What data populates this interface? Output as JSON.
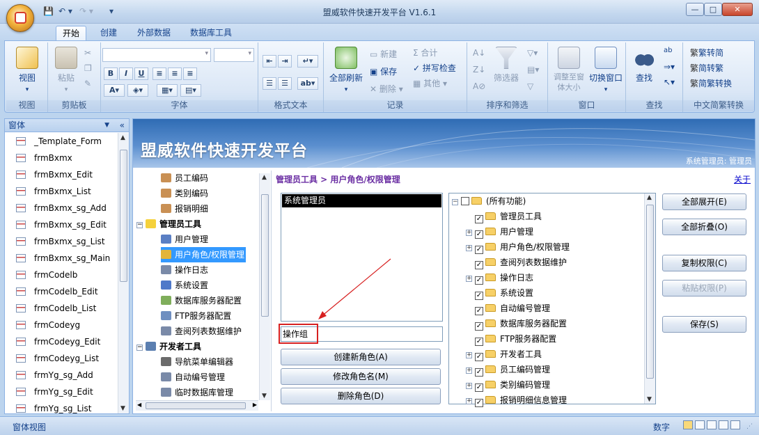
{
  "window": {
    "title": "盟威软件快速开发平台 V1.6.1",
    "minimize": "—",
    "maximize": "□",
    "close": "✕"
  },
  "quick_access": [
    "💾",
    "↶ ▾",
    "↷ ▾",
    "▾"
  ],
  "ribbon_tabs": [
    "开始",
    "创建",
    "外部数据",
    "数据库工具"
  ],
  "ribbon_right": [
    "?",
    "–",
    "▫",
    "✕"
  ],
  "ribbon": {
    "groups": [
      {
        "label": "视图",
        "buttons": [
          "视图"
        ]
      },
      {
        "label": "剪贴板",
        "buttons": [
          "粘贴"
        ]
      },
      {
        "label": "字体",
        "buttons": [
          "B",
          "I",
          "U"
        ]
      },
      {
        "label": "格式文本",
        "buttons": []
      },
      {
        "label": "记录",
        "buttons": [
          "全部刷新",
          "新建",
          "保存",
          "删除",
          "合计",
          "拼写检查",
          "其他"
        ]
      },
      {
        "label": "排序和筛选",
        "buttons": [
          "筛选器"
        ]
      },
      {
        "label": "窗口",
        "buttons": [
          "调整至窗体大小",
          "切换窗口"
        ]
      },
      {
        "label": "查找",
        "buttons": [
          "查找"
        ]
      },
      {
        "label": "中文简繁转换",
        "buttons": [
          "繁转简",
          "简转繁",
          "简繁转换"
        ]
      }
    ]
  },
  "leftnav": {
    "header": "窗体",
    "items": [
      "_Template_Form",
      "frmBxmx",
      "frmBxmx_Edit",
      "frmBxmx_List",
      "frmBxmx_sg_Add",
      "frmBxmx_sg_Edit",
      "frmBxmx_sg_List",
      "frmBxmx_sg_Main",
      "frmCodelb",
      "frmCodelb_Edit",
      "frmCodelb_List",
      "frmCodeyg",
      "frmCodeyg_Edit",
      "frmCodeyg_List",
      "frmYg_sg_Add",
      "frmYg_sg_Edit",
      "frmYg_sg_List"
    ]
  },
  "banner": {
    "title": "盟威软件快速开发平台",
    "user": "系统管理员: 管理员"
  },
  "menu_tree": [
    {
      "label": "员工编码",
      "level": 2
    },
    {
      "label": "类别编码",
      "level": 2
    },
    {
      "label": "报销明细",
      "level": 2
    },
    {
      "label": "管理员工具",
      "level": 1
    },
    {
      "label": "用户管理",
      "level": 2
    },
    {
      "label": "用户角色/权限管理",
      "level": 2
    },
    {
      "label": "操作日志",
      "level": 2
    },
    {
      "label": "系统设置",
      "level": 2
    },
    {
      "label": "数据库服务器配置",
      "level": 2
    },
    {
      "label": "FTP服务器配置",
      "level": 2
    },
    {
      "label": "查阅列表数据维护",
      "level": 2
    },
    {
      "label": "开发者工具",
      "level": 1
    },
    {
      "label": "导航菜单编辑器",
      "level": 2
    },
    {
      "label": "自动编号管理",
      "level": 2
    },
    {
      "label": "临时数据库管理",
      "level": 2
    }
  ],
  "breadcrumb": "管理员工具 > 用户角色/权限管理",
  "about_link": "关于",
  "roles": {
    "items": [
      "系统管理员"
    ],
    "input_value": "操作组"
  },
  "role_buttons": [
    "创建新角色(A)",
    "修改角色名(M)",
    "删除角色(D)"
  ],
  "permission_tree": {
    "root": "(所有功能)",
    "items": [
      "管理员工具",
      "用户管理",
      "用户角色/权限管理",
      "查阅列表数据维护",
      "操作日志",
      "系统设置",
      "自动编号管理",
      "数据库服务器配置",
      "FTP服务器配置",
      "开发者工具",
      "员工编码管理",
      "类别编码管理",
      "报销明细信息管理"
    ],
    "expandable": [
      false,
      true,
      true,
      false,
      true,
      false,
      false,
      false,
      false,
      true,
      true,
      true,
      true
    ]
  },
  "right_buttons": [
    "全部展开(E)",
    "全部折叠(O)",
    "复制权限(C)",
    "粘贴权限(P)",
    "保存(S)"
  ],
  "statusbar": {
    "left": "窗体视图",
    "mode": "数字"
  },
  "colors": {
    "selection": "#3399ff",
    "breadcrumb": "#6b2fa3",
    "highlight_box": "#d72020",
    "banner_top": "#2f6cb4"
  }
}
